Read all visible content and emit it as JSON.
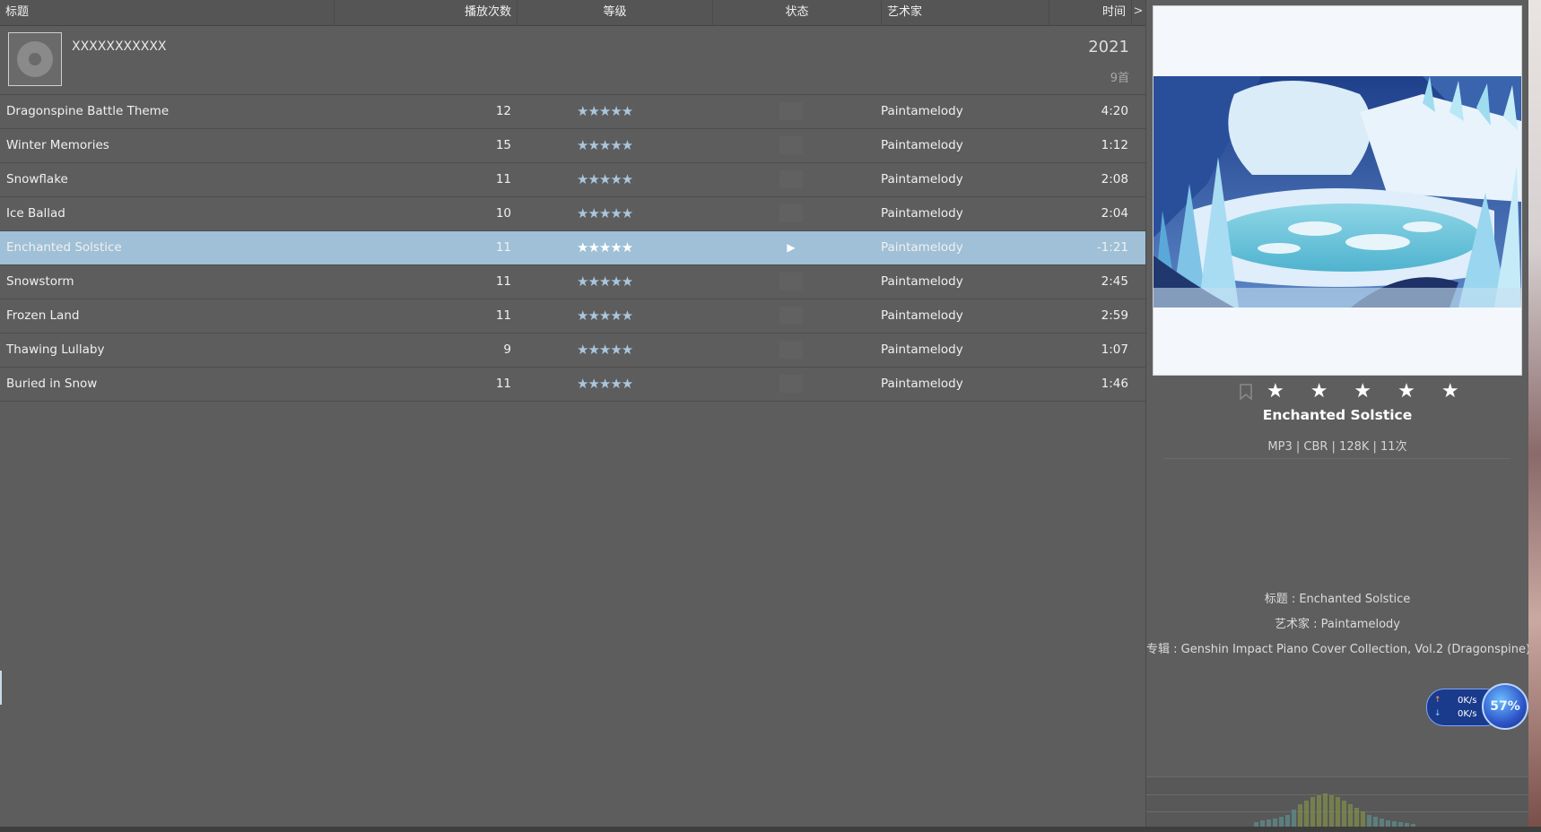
{
  "columns": {
    "title": "标题",
    "plays": "播放次数",
    "rating": "等级",
    "status": "状态",
    "artist": "艺术家",
    "time": "时间",
    "expand": ">"
  },
  "album": {
    "name": "XXXXXXXXXXX",
    "year": "2021",
    "count": "9首"
  },
  "tracks": [
    {
      "title": "Dragonspine Battle Theme",
      "plays": "12",
      "rating": "★★★★★",
      "status": "",
      "artist": "Paintamelody",
      "time": "4:20"
    },
    {
      "title": "Winter Memories",
      "plays": "15",
      "rating": "★★★★★",
      "status": "",
      "artist": "Paintamelody",
      "time": "1:12"
    },
    {
      "title": "Snowflake",
      "plays": "11",
      "rating": "★★★★★",
      "status": "",
      "artist": "Paintamelody",
      "time": "2:08"
    },
    {
      "title": "Ice Ballad",
      "plays": "10",
      "rating": "★★★★★",
      "status": "",
      "artist": "Paintamelody",
      "time": "2:04"
    },
    {
      "title": "Enchanted Solstice",
      "plays": "11",
      "rating": "★★★★★",
      "status": "▶",
      "artist": "Paintamelody",
      "time": "-1:21"
    },
    {
      "title": "Snowstorm",
      "plays": "11",
      "rating": "★★★★★",
      "status": "",
      "artist": "Paintamelody",
      "time": "2:45"
    },
    {
      "title": "Frozen Land",
      "plays": "11",
      "rating": "★★★★★",
      "status": "",
      "artist": "Paintamelody",
      "time": "2:59"
    },
    {
      "title": "Thawing Lullaby",
      "plays": "9",
      "rating": "★★★★★",
      "status": "",
      "artist": "Paintamelody",
      "time": "1:07"
    },
    {
      "title": "Buried in Snow",
      "plays": "11",
      "rating": "★★★★★",
      "status": "",
      "artist": "Paintamelody",
      "time": "1:46"
    }
  ],
  "selected_index": 4,
  "now_playing": {
    "stars": "★ ★ ★ ★ ★",
    "star_count": 5,
    "title": "Enchanted Solstice",
    "format": "MP3 | CBR | 128K | 11次",
    "meta_title": "标题 : Enchanted Solstice",
    "meta_artist": "艺术家 : Paintamelody",
    "meta_album": "专辑 : Genshin Impact Piano Cover Collection, Vol.2 (Dragonspine)"
  },
  "net_speed": {
    "up": "0K/s",
    "down": "0K/s",
    "percent": "57%",
    "up_arrow": "↑",
    "down_arrow": "↓"
  },
  "icons": {
    "album_placeholder": "disc-icon",
    "bookmark": "bookmark-icon",
    "play_indicator": "play-icon"
  },
  "colors": {
    "selection": "#9fc0d6",
    "star": "#a9c6dd",
    "background": "#5d5d5d"
  }
}
